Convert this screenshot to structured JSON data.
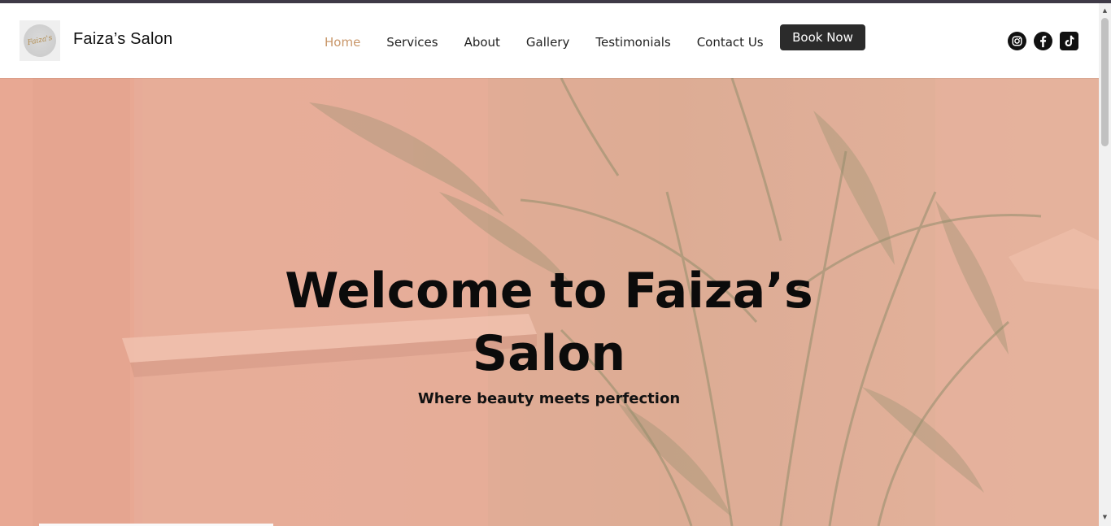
{
  "header": {
    "logo_text": "Faiza's",
    "brand": "Faiza’s Salon",
    "nav": [
      {
        "label": "Home",
        "active": true
      },
      {
        "label": "Services",
        "active": false
      },
      {
        "label": "About",
        "active": false
      },
      {
        "label": "Gallery",
        "active": false
      },
      {
        "label": "Testimonials",
        "active": false
      },
      {
        "label": "Contact Us",
        "active": false
      }
    ],
    "book_label": "Book Now",
    "socials": [
      "instagram-icon",
      "facebook-icon",
      "tiktok-icon"
    ]
  },
  "hero": {
    "title": "Welcome to Faiza’s Salon",
    "subtitle": "Where beauty meets perfection"
  },
  "colors": {
    "accent": "#c9976a",
    "button": "#2b2b2b",
    "hero_bg": "#e4ab96"
  }
}
